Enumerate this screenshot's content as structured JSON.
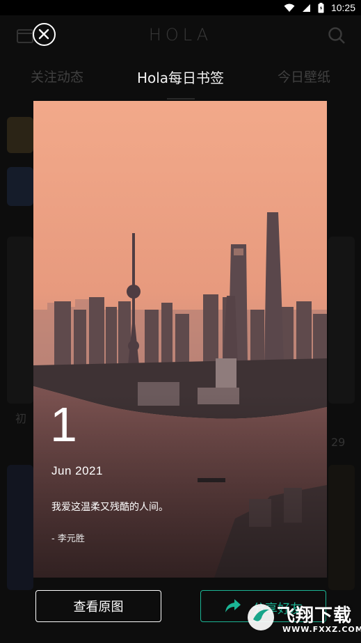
{
  "status_bar": {
    "time": "10:25",
    "icons": [
      "wifi-icon",
      "signal-icon",
      "battery-icon"
    ]
  },
  "background_app": {
    "logo": "HOLA",
    "tabs": [
      {
        "label": "关注动态"
      },
      {
        "label": "Hola每日书签"
      },
      {
        "label": "今日壁纸"
      }
    ],
    "partial_texts": [
      "初",
      "29"
    ]
  },
  "card": {
    "day": "1",
    "month_year": "Jun  2021",
    "quote": "我爱这温柔又残酷的人间。",
    "author": "- 李元胜"
  },
  "buttons": {
    "view_original": "查看原图",
    "share": "分享好友"
  },
  "watermark": {
    "brand": "飞翔下载",
    "url": "WWW.FXXZ.COM"
  },
  "colors": {
    "accent": "#1bb595",
    "sky_top": "#f0a783",
    "sky_bottom": "#c98a78",
    "river": "#6f4a48"
  }
}
